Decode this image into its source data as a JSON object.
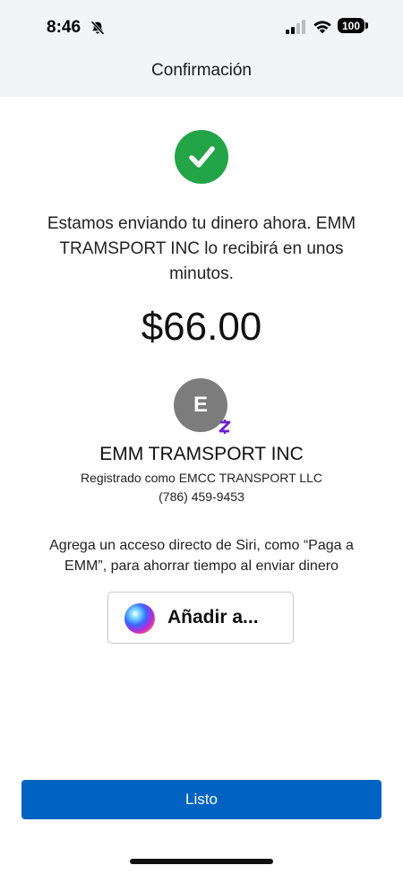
{
  "status_bar": {
    "time": "8:46",
    "battery": "100",
    "icons": [
      "bell-slash-icon",
      "cellular-signal-icon",
      "wifi-icon",
      "battery-icon"
    ]
  },
  "header": {
    "title": "Confirmación"
  },
  "confirmation": {
    "icon": "checkmark-circle-icon",
    "message": "Estamos enviando tu dinero ahora. EMM TRAMSPORT INC lo recibirá en unos minutos.",
    "amount": "$66.00"
  },
  "recipient": {
    "avatar_initial": "E",
    "badge_icon": "zelle-z-icon",
    "name": "EMM TRAMSPORT INC",
    "registered_as": "Registrado como EMCC TRANSPORT LLC",
    "phone": "(786) 459-9453"
  },
  "siri": {
    "prompt": "Agrega un acceso directo de Siri, como “Paga a EMM”, para ahorrar tiempo al enviar dinero",
    "button_label": "Añadir a..."
  },
  "footer": {
    "done_label": "Listo"
  },
  "colors": {
    "header_background": "#f3f4f6",
    "success_green": "#22a447",
    "primary_blue": "#0063c1",
    "avatar_gray": "#7c7c7c",
    "zelle_purple": "#6d1ed4"
  }
}
